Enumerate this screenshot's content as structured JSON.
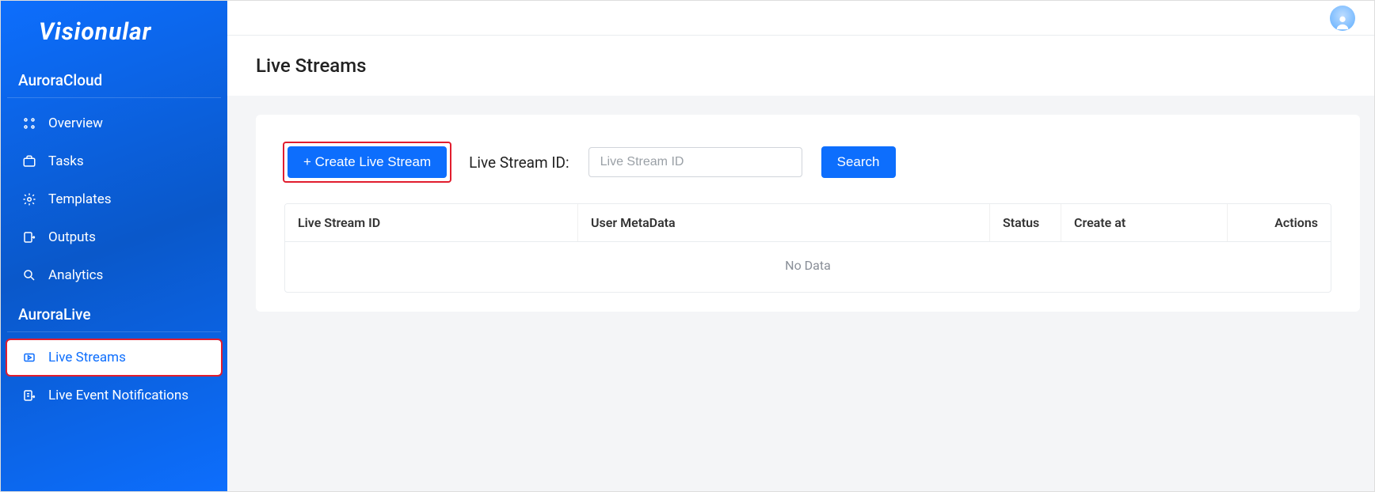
{
  "brand": "Visionular",
  "sidebar": {
    "section1": {
      "title": "AuroraCloud"
    },
    "section2": {
      "title": "AuroraLive"
    },
    "items1": [
      {
        "label": "Overview"
      },
      {
        "label": "Tasks"
      },
      {
        "label": "Templates"
      },
      {
        "label": "Outputs"
      },
      {
        "label": "Analytics"
      }
    ],
    "items2": [
      {
        "label": "Live Streams"
      },
      {
        "label": "Live Event Notifications"
      }
    ]
  },
  "page": {
    "title": "Live Streams"
  },
  "toolbar": {
    "create_label": "+ Create Live Stream",
    "id_label": "Live Stream ID:",
    "id_placeholder": "Live Stream ID",
    "search_label": "Search"
  },
  "table": {
    "columns": {
      "id": "Live Stream ID",
      "meta": "User MetaData",
      "status": "Status",
      "created": "Create at",
      "actions": "Actions"
    },
    "empty": "No Data"
  }
}
